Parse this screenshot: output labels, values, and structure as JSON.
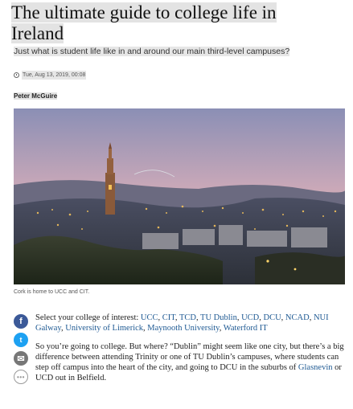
{
  "article": {
    "headline_line1": "The ultimate guide to college life in",
    "headline_line2": "Ireland",
    "standfirst": "Just what is student life like in and around our main third-level campuses?",
    "date": "Tue, Aug 13, 2019, 00:08",
    "author": "Peter McGuire",
    "image_caption": "Cork is home to UCC and CIT."
  },
  "share": {
    "facebook_glyph": "f",
    "twitter_glyph": "t",
    "email_glyph": "✉",
    "more_glyph": "•••",
    "icons": [
      "facebook-icon",
      "twitter-icon",
      "email-icon",
      "more-icon"
    ]
  },
  "body": {
    "colleges_intro": "Select your college of interest: ",
    "colleges": [
      "UCC",
      "CIT",
      "TCD",
      "TU Dublin",
      "UCD",
      "DCU",
      "NCAD",
      "NUI Galway",
      "University of Limerick",
      "Maynooth University",
      "Waterford IT"
    ],
    "para2_part1": "So you’re going to college. But where? “Dublin” might seem like one city, but there’s a big difference between attending Trinity or one of TU Dublin’s campuses, where students can step off campus into the heart of the city, and going to DCU in the suburbs of ",
    "para2_link": "Glasnevin",
    "para2_part2": " or UCD out in Belfield."
  },
  "colors": {
    "link": "#1f5a93",
    "facebook": "#3b5998",
    "twitter": "#1da1f2"
  }
}
